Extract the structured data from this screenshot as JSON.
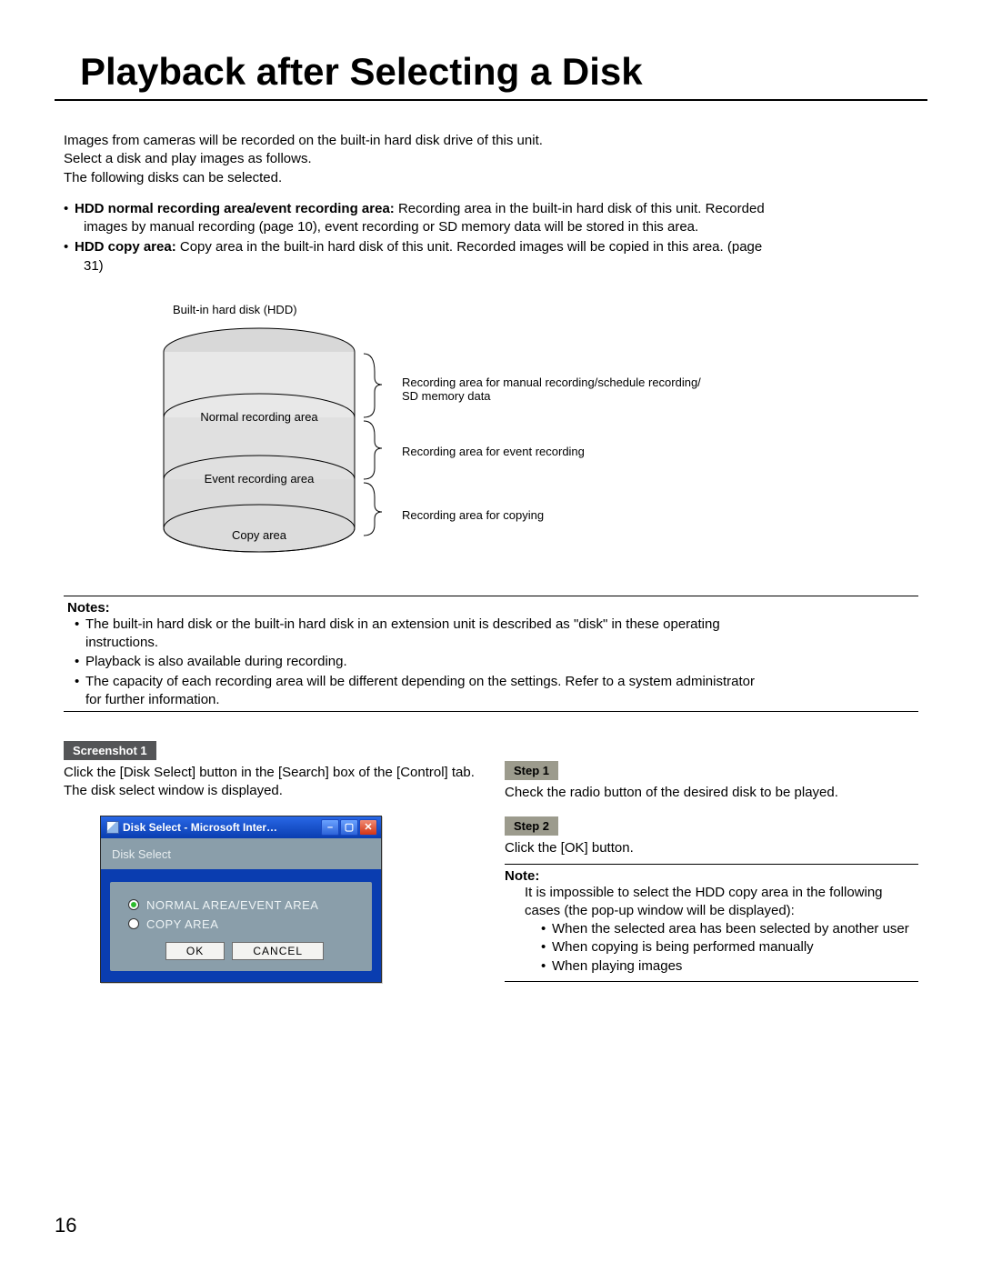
{
  "title": "Playback after Selecting a Disk",
  "intro": {
    "l1": "Images from cameras will be recorded on the built-in hard disk drive of this unit.",
    "l2": "Select a disk and play images as follows.",
    "l3": "The following disks can be selected."
  },
  "bullets": {
    "b1_label": "HDD normal recording area/event recording area:",
    "b1_text": " Recording area in the built-in hard disk of this unit. Recorded",
    "b1_cont": "images by manual recording (page 10), event recording or SD memory data will be stored in this area.",
    "b2_label": "HDD copy area:",
    "b2_text": " Copy area in the built-in hard disk of this unit. Recorded images will be copied in this area. (page",
    "b2_cont": "31)"
  },
  "diagram": {
    "caption": "Built-in hard disk (HDD)",
    "normal": "Normal recording area",
    "event": "Event recording area",
    "copy": "Copy area",
    "anno1a": "Recording area for manual recording/schedule recording/",
    "anno1b": "SD memory data",
    "anno2": "Recording area for event recording",
    "anno3": "Recording area for copying"
  },
  "notes_label": "Notes:",
  "notes": {
    "n1a": "The built-in hard disk or the built-in hard disk in an extension unit is described as \"disk\" in these operating",
    "n1b": "instructions.",
    "n2": "Playback is also available during recording.",
    "n3a": "The capacity of each recording area will be different depending on the settings. Refer to a system administrator",
    "n3b": "for further information."
  },
  "screenshot_label": "Screenshot 1",
  "left_desc": "Click the [Disk Select] button in the [Search] box of the [Control] tab. The disk select window is displayed.",
  "dialog": {
    "title": "Disk Select - Microsoft Inter…",
    "panel_title": "Disk Select",
    "opt1": "NORMAL AREA/EVENT AREA",
    "opt2": "COPY AREA",
    "ok": "OK",
    "cancel": "CANCEL"
  },
  "step1_label": "Step 1",
  "step1_text": "Check the radio button of the desired disk to be played.",
  "step2_label": "Step 2",
  "step2_text": "Click the [OK] button.",
  "note2_label": "Note:",
  "note2_body": "It is impossible to select the HDD copy area in the following cases (the pop-up window will be displayed):",
  "note2_list": {
    "a": "When the selected area has been selected by another user",
    "b": "When copying is being performed manually",
    "c": "When playing images"
  },
  "page_num": "16"
}
